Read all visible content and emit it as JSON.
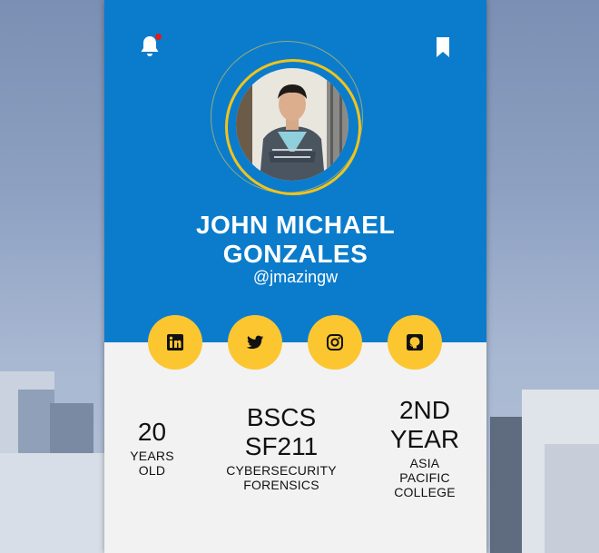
{
  "profile": {
    "name_line1": "JOHN MICHAEL",
    "name_line2": "GONZALES",
    "handle": "@jmazingw"
  },
  "header": {
    "bell_icon": "bell-icon",
    "bell_has_notification": true,
    "bookmark_icon": "bookmark-icon"
  },
  "social": [
    {
      "icon": "linkedin-icon"
    },
    {
      "icon": "twitter-icon"
    },
    {
      "icon": "instagram-icon"
    },
    {
      "icon": "github-icon"
    }
  ],
  "stats": [
    {
      "value_lines": [
        "20"
      ],
      "label_lines": [
        "YEARS",
        "OLD"
      ]
    },
    {
      "value_lines": [
        "BSCS",
        "SF211"
      ],
      "label_lines": [
        "CYBERSECURITY",
        "FORENSICS"
      ]
    },
    {
      "value_lines": [
        "2ND",
        "YEAR"
      ],
      "label_lines": [
        "ASIA",
        "PACIFIC",
        "COLLEGE"
      ]
    }
  ],
  "colors": {
    "header_blue": "#0b7ccc",
    "accent_yellow": "#fcc631",
    "card_bg": "#f2f2f2",
    "notification_red": "#e21b1b"
  }
}
